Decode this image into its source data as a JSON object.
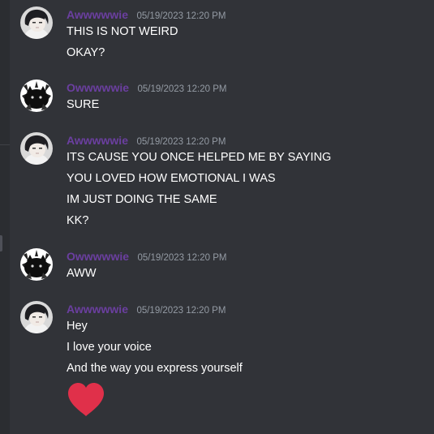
{
  "users": {
    "a": {
      "name": "Awwwwwie",
      "avatar_icon": "anime-boy-avatar"
    },
    "b": {
      "name": "Owwwwwie",
      "avatar_icon": "black-cat-avatar"
    }
  },
  "messages": [
    {
      "author": "Awwwwwie",
      "timestamp": "05/19/2023 12:20 PM",
      "lines": [
        "THIS IS NOT WEIRD",
        "OKAY?"
      ]
    },
    {
      "author": "Owwwwwie",
      "timestamp": "05/19/2023 12:20 PM",
      "lines": [
        "SURE"
      ]
    },
    {
      "author": "Awwwwwie",
      "timestamp": "05/19/2023 12:20 PM",
      "lines": [
        "ITS CAUSE YOU ONCE HELPED ME BY SAYING",
        "YOU LOVED HOW EMOTIONAL I WAS",
        "IM JUST DOING THE SAME",
        "KK?"
      ]
    },
    {
      "author": "Owwwwwie",
      "timestamp": "05/19/2023 12:20 PM",
      "lines": [
        "AWW"
      ]
    },
    {
      "author": "Awwwwwie",
      "timestamp": "05/19/2023 12:20 PM",
      "lines": [
        "Hey",
        "I love your voice",
        "And the way you express yourself"
      ],
      "emoji": "red-heart-icon"
    }
  ],
  "colors": {
    "background": "#313338",
    "username": "#6b3fa0",
    "timestamp": "#949ba4",
    "text": "#ffffff",
    "heart": "#e0304a"
  }
}
